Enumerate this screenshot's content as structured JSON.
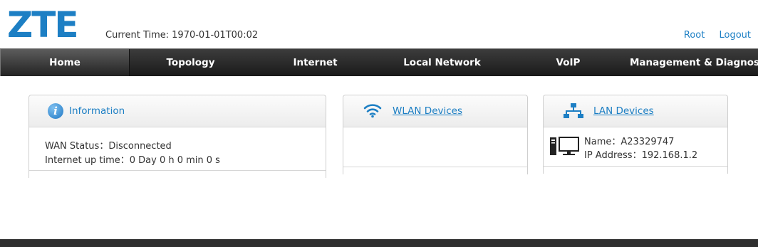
{
  "header": {
    "logo": "ZTE",
    "current_time_label": "Current Time:",
    "current_time_value": "1970-01-01T00:02",
    "links": {
      "root": "Root",
      "logout": "Logout"
    }
  },
  "nav": {
    "active": "Home",
    "items": [
      "Home",
      "Topology",
      "Internet",
      "Local Network",
      "VoIP",
      "Management & Diagnosis"
    ]
  },
  "cards": {
    "information": {
      "title": "Information",
      "wan_status_label": "WAN Status：",
      "wan_status_value": "Disconnected",
      "uptime_label": "Internet up time：",
      "uptime_value": "0 Day 0 h 0 min 0 s"
    },
    "wlan": {
      "title": "WLAN Devices"
    },
    "lan": {
      "title": "LAN Devices",
      "device": {
        "name_label": "Name：",
        "name_value": "A23329747",
        "ip_label": "IP Address：",
        "ip_value": "192.168.1.2"
      }
    }
  },
  "colors": {
    "brand": "#1d7fc4",
    "nav_bg": "#1a1a1a",
    "footer_bg": "#2f2f2f"
  }
}
